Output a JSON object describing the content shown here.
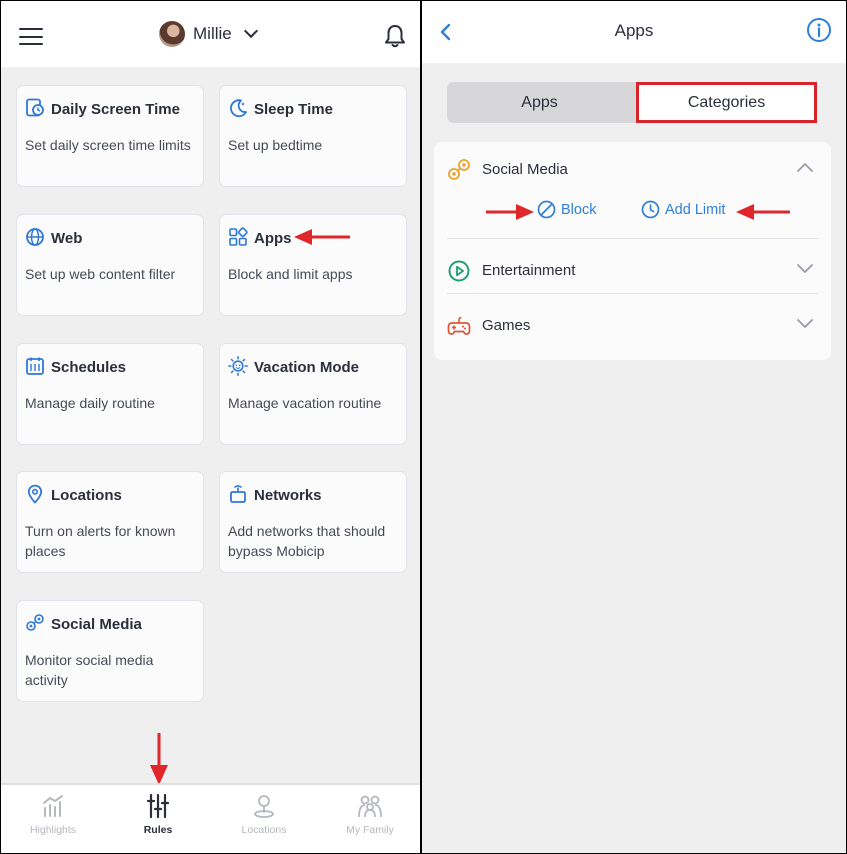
{
  "left": {
    "user_name": "Millie",
    "cards": [
      {
        "title": "Daily Screen Time",
        "desc": "Set daily screen time limits",
        "icon": "screen-time-icon"
      },
      {
        "title": "Sleep Time",
        "desc": "Set up bedtime",
        "icon": "moon-icon"
      },
      {
        "title": "Web",
        "desc": "Set up web content filter",
        "icon": "globe-icon"
      },
      {
        "title": "Apps",
        "desc": "Block and limit apps",
        "icon": "apps-grid-icon"
      },
      {
        "title": "Schedules",
        "desc": "Manage daily routine",
        "icon": "calendar-icon"
      },
      {
        "title": "Vacation Mode",
        "desc": "Manage vacation routine",
        "icon": "sun-icon"
      },
      {
        "title": "Locations",
        "desc": "Turn on alerts for known places",
        "icon": "location-pin-icon"
      },
      {
        "title": "Networks",
        "desc": "Add networks that should bypass Mobicip",
        "icon": "network-icon"
      },
      {
        "title": "Social Media",
        "desc": "Monitor social media activity",
        "icon": "social-media-icon"
      }
    ],
    "nav": [
      {
        "label": "Highlights",
        "icon": "chart-icon",
        "active": false
      },
      {
        "label": "Rules",
        "icon": "sliders-icon",
        "active": true
      },
      {
        "label": "Locations",
        "icon": "location-person-icon",
        "active": false
      },
      {
        "label": "My Family",
        "icon": "family-icon",
        "active": false
      }
    ]
  },
  "right": {
    "title": "Apps",
    "tabs": [
      {
        "label": "Apps",
        "selected": false
      },
      {
        "label": "Categories",
        "selected": true
      }
    ],
    "categories": [
      {
        "label": "Social Media",
        "expanded": true,
        "icon": "social-media-icon"
      },
      {
        "label": "Entertainment",
        "expanded": false,
        "icon": "play-icon"
      },
      {
        "label": "Games",
        "expanded": false,
        "icon": "gamepad-icon"
      }
    ],
    "actions": {
      "block": "Block",
      "add_limit": "Add Limit"
    }
  },
  "colors": {
    "accent_blue": "#2f7fd8",
    "card_blue": "#2e78d6",
    "highlight_red": "#d8232a",
    "social_orange": "#f0a12a",
    "entertainment_green": "#1f9d6e",
    "games_red": "#e0533a",
    "background": "#efefef"
  }
}
